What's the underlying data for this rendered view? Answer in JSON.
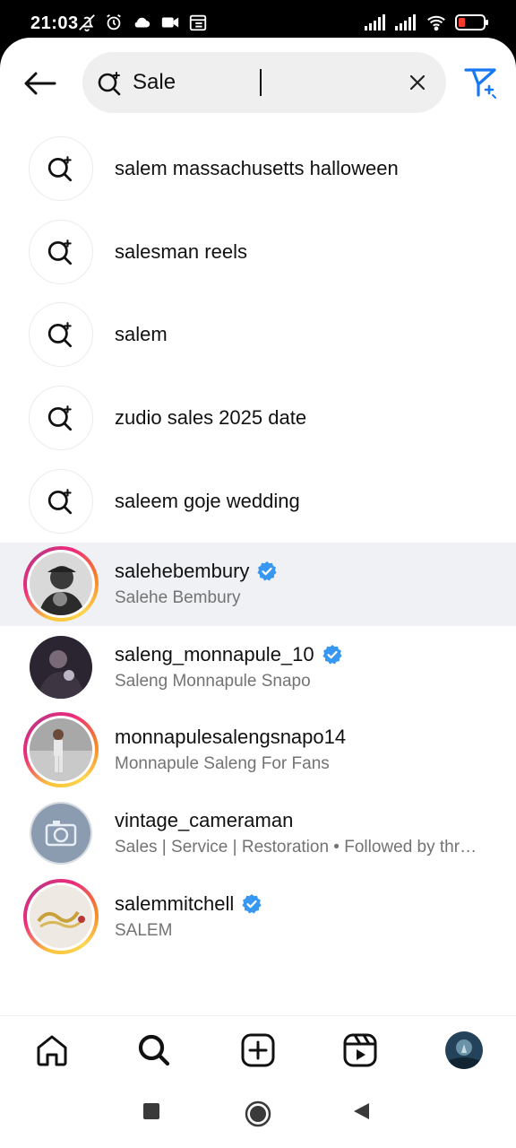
{
  "status_bar": {
    "time": "21:03"
  },
  "search": {
    "query": "Sale",
    "icons": {
      "search": "search-sparkle-icon",
      "clear": "close-icon",
      "back": "back-arrow-icon",
      "filter": "send-filter-icon"
    }
  },
  "keyword_suggestions": [
    {
      "text": "salem massachusetts halloween",
      "icon": "search-sparkle-icon"
    },
    {
      "text": "salesman reels",
      "icon": "search-sparkle-icon"
    },
    {
      "text": "salem",
      "icon": "search-sparkle-icon"
    },
    {
      "text": "zudio sales 2025 date",
      "icon": "search-sparkle-icon"
    },
    {
      "text": "saleem goje wedding",
      "icon": "search-sparkle-icon"
    }
  ],
  "accounts": [
    {
      "username": "salehebembury",
      "full_name": "Salehe Bembury",
      "verified": true,
      "story_ring": true,
      "highlighted": true
    },
    {
      "username": "saleng_monnapule_10",
      "full_name": "Saleng Monnapule Snapo",
      "verified": true,
      "story_ring": false,
      "highlighted": false
    },
    {
      "username": "monnapulesalengsnapo14",
      "full_name": "Monnapule Saleng For Fans",
      "verified": false,
      "story_ring": true,
      "highlighted": false
    },
    {
      "username": "vintage_cameraman",
      "full_name": "Sales | Service | Restoration • Followed by thr…",
      "verified": false,
      "story_ring": false,
      "highlighted": false
    },
    {
      "username": "salemmitchell",
      "full_name": "SALEM",
      "verified": true,
      "story_ring": true,
      "highlighted": false
    }
  ],
  "bottom_nav": [
    "home-icon",
    "search-icon",
    "create-post-icon",
    "reels-icon",
    "profile-avatar"
  ],
  "system_nav": [
    "recents-square-icon",
    "home-circle-icon",
    "back-triangle-icon"
  ],
  "colors": {
    "verified_blue": "#3897f0",
    "filter_blue": "#1877f2",
    "secondary_text": "#737373",
    "highlight_row": "#eff1f4"
  }
}
